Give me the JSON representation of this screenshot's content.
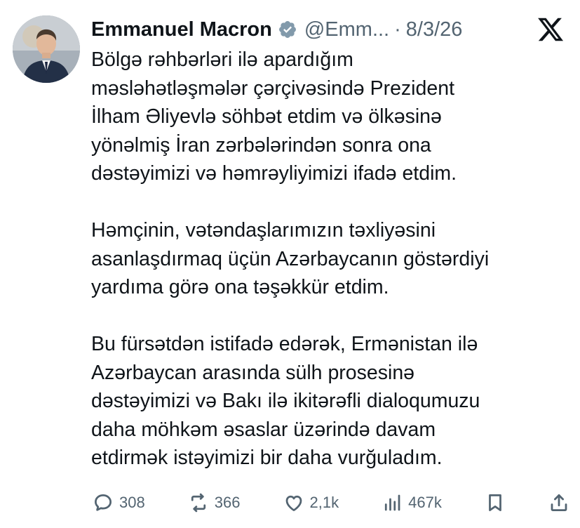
{
  "author": {
    "display_name": "Emmanuel Macron",
    "handle": "@Emm...",
    "separator": "·",
    "date": "8/3/26"
  },
  "colors": {
    "verified_badge": "#829aab",
    "text": "#0f1419",
    "muted": "#536471"
  },
  "tweet": {
    "paragraphs": [
      {
        "lines": [
          "Bölgə rəhbərləri ilə apardığım",
          "məsləhətləşmələr çərçivəsində Prezident",
          "İlham Əliyevlə söhbət etdim və ölkəsinə",
          "yönəlmiş İran zərbələrindən sonra ona",
          "dəstəyimizi və həmrəyliyimizi ifadə etdim."
        ]
      },
      {
        "lines": [
          "Həmçinin, vətəndaşlarımızın təxliyəsini",
          "asanlaşdırmaq üçün Azərbaycanın göstərdiyi",
          "yardıma görə ona təşəkkür etdim."
        ]
      },
      {
        "lines": [
          "Bu fürsətdən istifadə edərək, Ermənistan ilə",
          "Azərbaycan arasında sülh prosesinə",
          "dəstəyimizi və Bakı ilə ikitərəfli dialoqumuzu",
          "daha möhkəm əsaslar üzərində davam",
          "etdirmək istəyimizi bir daha vurğuladım."
        ]
      }
    ]
  },
  "actions": {
    "replies": "308",
    "reposts": "366",
    "likes": "2,1k",
    "views": "467k"
  },
  "icons": [
    "verified-badge-icon",
    "x-logo-icon",
    "reply-icon",
    "repost-icon",
    "like-icon",
    "views-icon",
    "bookmark-icon",
    "share-icon"
  ]
}
